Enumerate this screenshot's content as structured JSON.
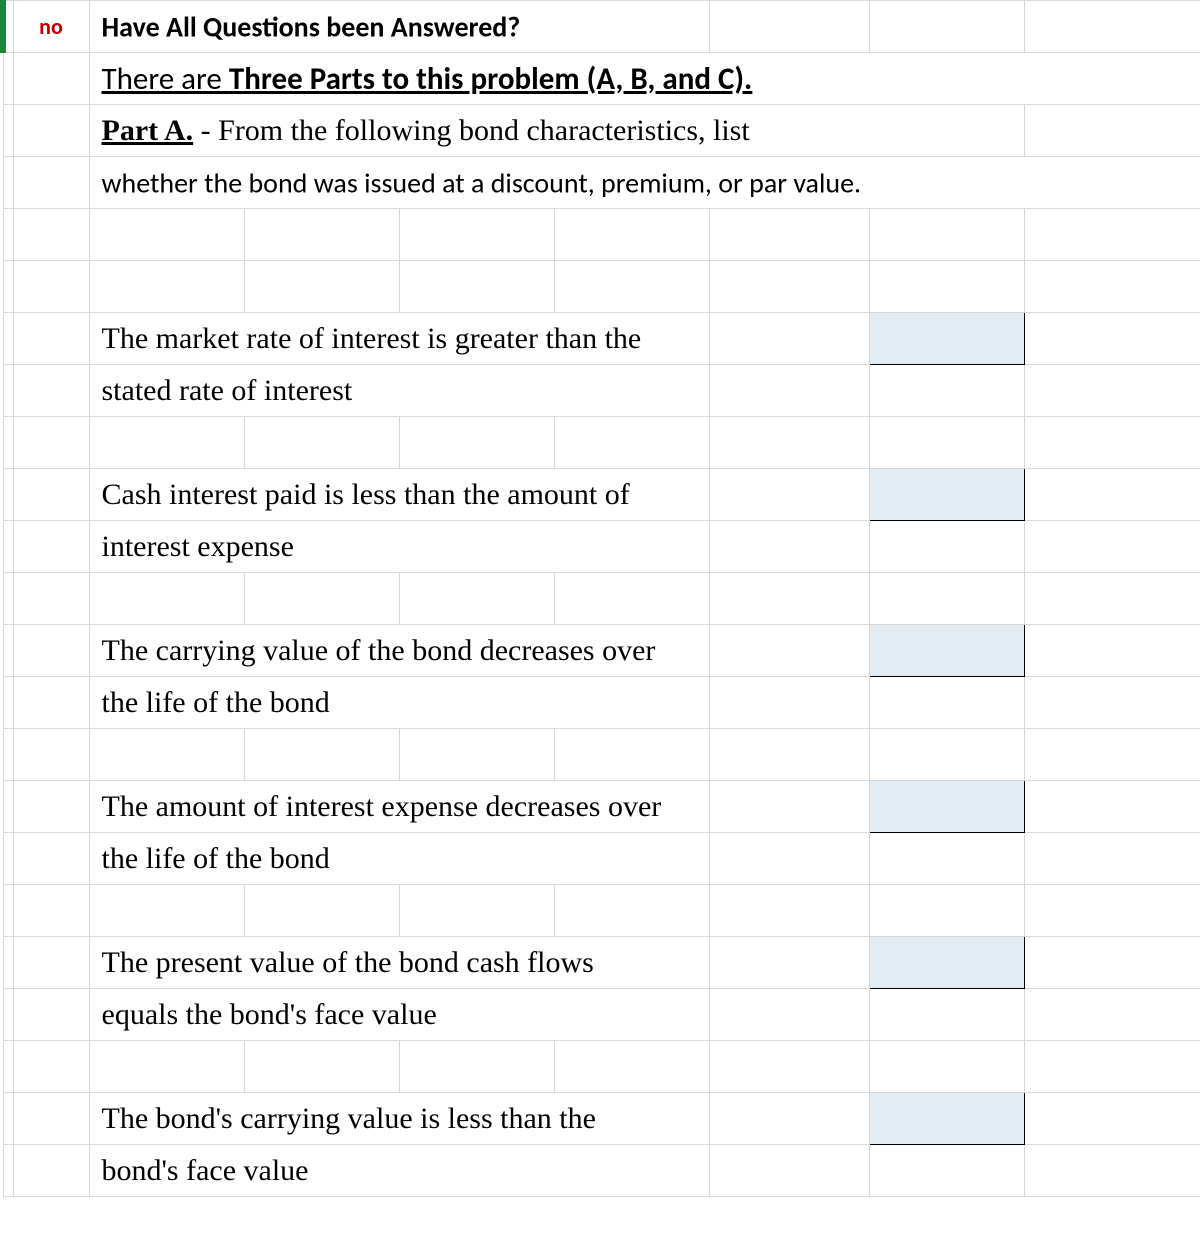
{
  "header": {
    "no_label": "no",
    "question_header": "Have All Questions been Answered?",
    "title_prefix": "There are ",
    "title_bold": "Three Parts to this problem (A, B, and C).",
    "part_a_label": "Part A.",
    "part_a_rest": " - From the following bond characteristics, list",
    "part_a_line2": "whether the bond was issued at a discount, premium, or par value."
  },
  "items": [
    {
      "line1": "The market rate of interest is greater than the",
      "line2": "stated rate of interest",
      "answer": ""
    },
    {
      "line1": "Cash interest paid is less than the amount of",
      "line2": "interest expense",
      "answer": ""
    },
    {
      "line1": "The carrying value of the bond decreases over",
      "line2": "the life of the bond",
      "answer": ""
    },
    {
      "line1": "The amount of interest expense decreases over",
      "line2": "the life of the bond",
      "answer": ""
    },
    {
      "line1": "The present value of the bond cash flows",
      "line2": "equals the bond's face value",
      "answer": ""
    },
    {
      "line1": "The bond's carrying value is less than the",
      "line2": "bond's face value",
      "answer": ""
    }
  ]
}
